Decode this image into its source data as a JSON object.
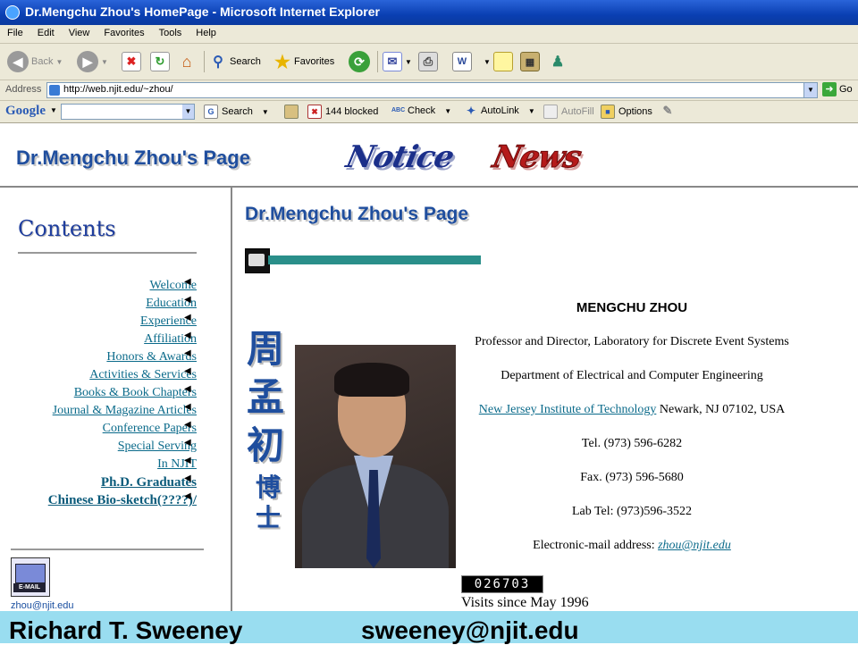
{
  "window": {
    "title": "Dr.Mengchu Zhou's HomePage - Microsoft Internet Explorer",
    "icon": "ie-icon"
  },
  "menu": [
    "File",
    "Edit",
    "View",
    "Favorites",
    "Tools",
    "Help"
  ],
  "toolbar": {
    "back_label": "Back",
    "search_label": "Search",
    "favorites_label": "Favorites"
  },
  "address": {
    "label": "Address",
    "url": "http://web.njit.edu/~zhou/",
    "go_label": "Go"
  },
  "google_bar": {
    "logo": "Google",
    "search_label": "Search",
    "blocked_label": "144 blocked",
    "check_label": "Check",
    "autolink_label": "AutoLink",
    "autofill_label": "AutoFill",
    "options_label": "Options"
  },
  "header": {
    "site_title": "Dr.Mengchu Zhou's Page",
    "notice_logo": "Notice",
    "news_logo": "News"
  },
  "sidebar": {
    "title": "Contents",
    "items": [
      "Welcome",
      "Education",
      "Experience",
      "Affiliation",
      "Honors & Awards",
      "Activities & Services",
      "Books & Book Chapters",
      "Journal & Magazine Articles",
      "Conference Papers",
      "Special Serving",
      "In NJIT",
      "Ph.D. Graduates",
      "Chinese Bio-sketch(????)/"
    ],
    "email_icon_label": "E-MAIL",
    "email": "zhou@njit.edu"
  },
  "main": {
    "title": "Dr.Mengchu Zhou's Page",
    "chinese_name": [
      "周",
      "孟",
      "初"
    ],
    "chinese_title": [
      "博",
      "士"
    ],
    "name": "MENGCHU ZHOU",
    "position": "Professor and Director, Laboratory for Discrete Event Systems",
    "department": "Department of Electrical and Computer Engineering",
    "institute_link": "New Jersey Institute of Technology",
    "institute_address": " Newark, NJ 07102, USA",
    "tel": "Tel. (973) 596-6282",
    "fax": "Fax. (973) 596-5680",
    "lab_tel": "Lab Tel: (973)596-3522",
    "email_prefix": "Electronic-mail address: ",
    "email_link": "zhou@njit.edu",
    "counter": "026703",
    "visits": "Visits since May 1996"
  },
  "footer": {
    "author": "Richard T. Sweeney",
    "email": "sweeney@njit.edu"
  }
}
